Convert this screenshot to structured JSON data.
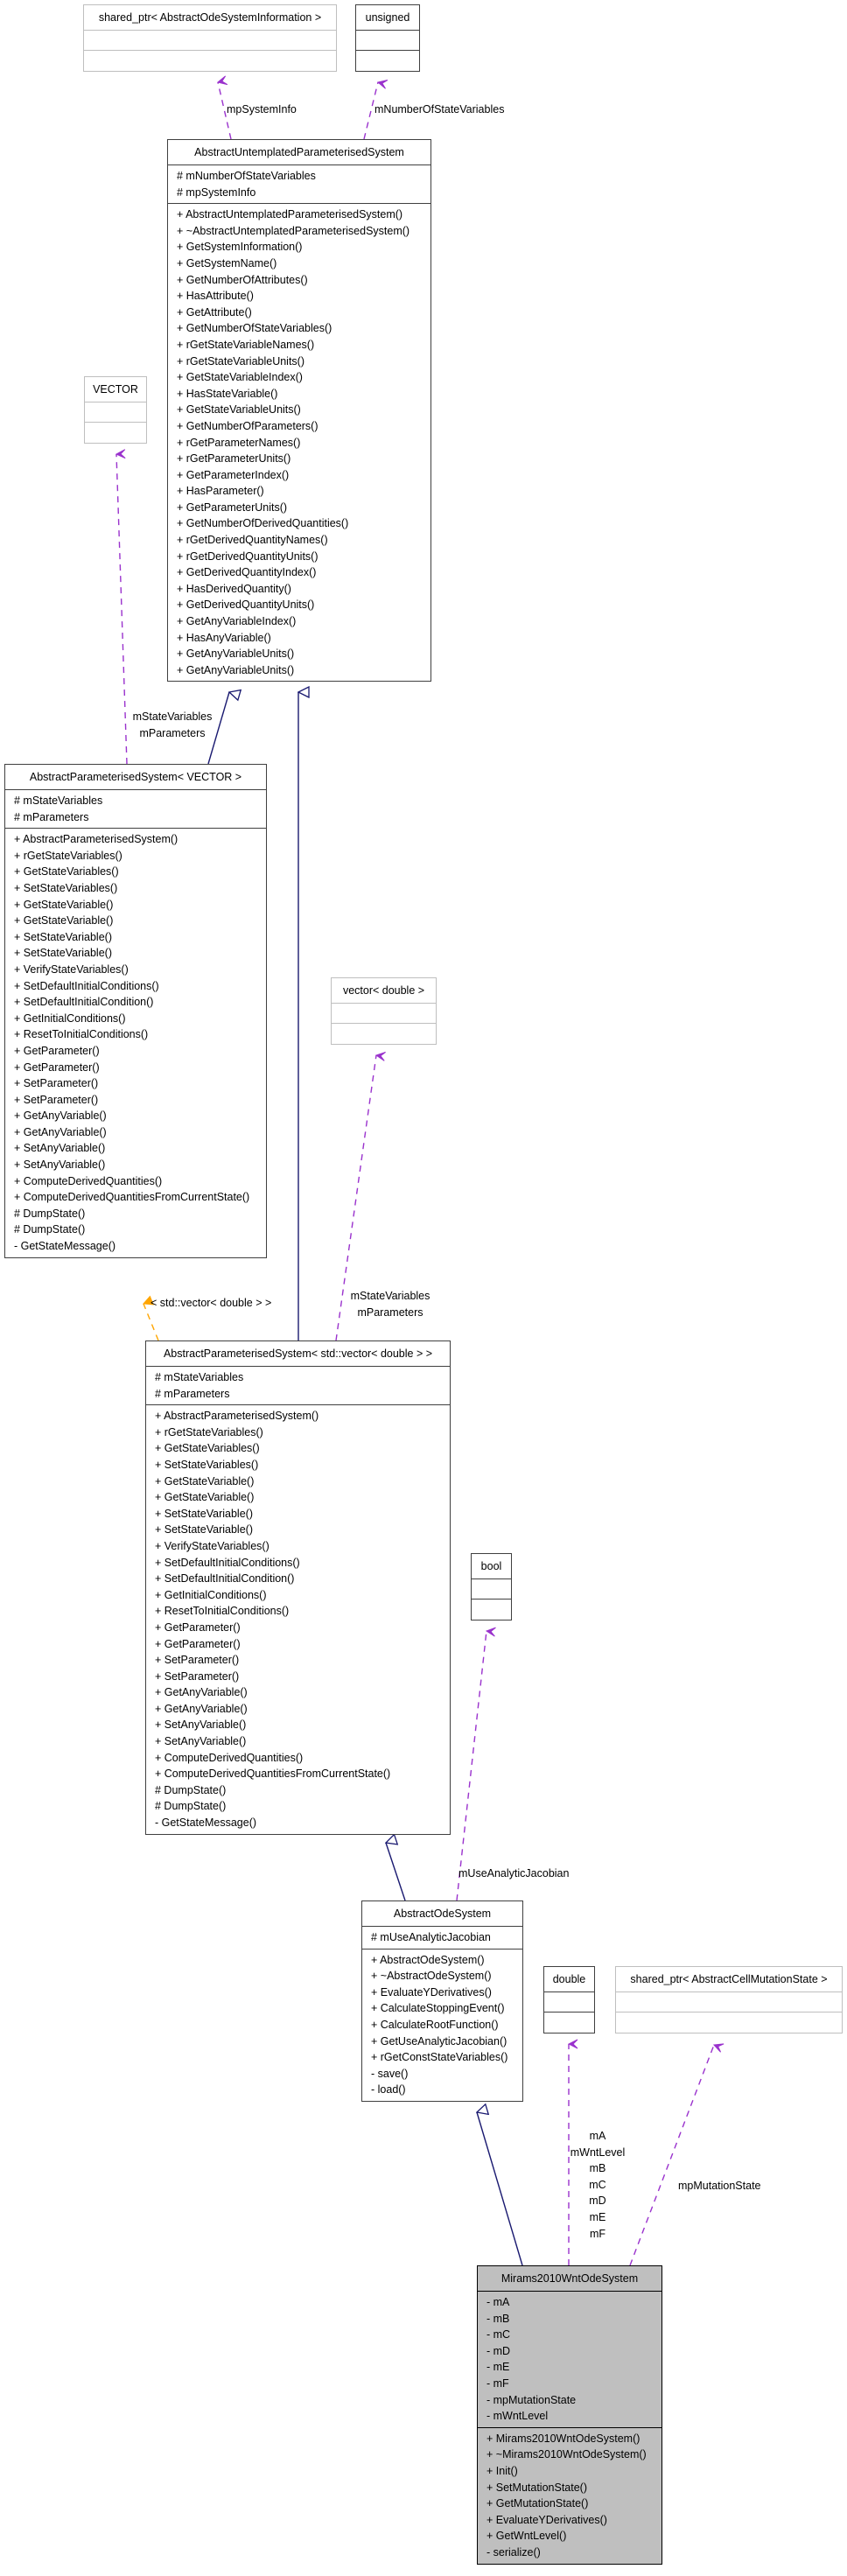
{
  "diagram": {
    "type": "doxygen-collaboration-graph",
    "colors": {
      "inheritance_edge": "#191970",
      "usage_edge": "#9a32cd",
      "template_edge": "#ffa500",
      "focus_fill": "#bfbfbf",
      "external_border": "#bfbfbf"
    }
  },
  "nodes": {
    "shared_ptr_info": {
      "title": "shared_ptr< AbstractOdeSystemInformation >",
      "attributes": [],
      "methods": []
    },
    "unsigned": {
      "title": "unsigned",
      "attributes": [],
      "methods": []
    },
    "untemplated": {
      "title": "AbstractUntemplatedParameterisedSystem",
      "attributes": [
        "# mNumberOfStateVariables",
        "# mpSystemInfo"
      ],
      "methods": [
        "+ AbstractUntemplatedParameterisedSystem()",
        "+ ~AbstractUntemplatedParameterisedSystem()",
        "+ GetSystemInformation()",
        "+ GetSystemName()",
        "+ GetNumberOfAttributes()",
        "+ HasAttribute()",
        "+ GetAttribute()",
        "+ GetNumberOfStateVariables()",
        "+ rGetStateVariableNames()",
        "+ rGetStateVariableUnits()",
        "+ GetStateVariableIndex()",
        "+ HasStateVariable()",
        "+ GetStateVariableUnits()",
        "+ GetNumberOfParameters()",
        "+ rGetParameterNames()",
        "+ rGetParameterUnits()",
        "+ GetParameterIndex()",
        "+ HasParameter()",
        "+ GetParameterUnits()",
        "+ GetNumberOfDerivedQuantities()",
        "+ rGetDerivedQuantityNames()",
        "+ rGetDerivedQuantityUnits()",
        "+ GetDerivedQuantityIndex()",
        "+ HasDerivedQuantity()",
        "+ GetDerivedQuantityUnits()",
        "+ GetAnyVariableIndex()",
        "+ HasAnyVariable()",
        "+ GetAnyVariableUnits()",
        "+ GetAnyVariableUnits()"
      ]
    },
    "vector_tpl": {
      "title": "VECTOR",
      "attributes": [],
      "methods": []
    },
    "param_vector": {
      "title": "AbstractParameterisedSystem< VECTOR >",
      "attributes": [
        "# mStateVariables",
        "# mParameters"
      ],
      "methods": [
        "+ AbstractParameterisedSystem()",
        "+ rGetStateVariables()",
        "+ GetStateVariables()",
        "+ SetStateVariables()",
        "+ GetStateVariable()",
        "+ GetStateVariable()",
        "+ SetStateVariable()",
        "+ SetStateVariable()",
        "+ VerifyStateVariables()",
        "+ SetDefaultInitialConditions()",
        "+ SetDefaultInitialCondition()",
        "+ GetInitialConditions()",
        "+ ResetToInitialConditions()",
        "+ GetParameter()",
        "+ GetParameter()",
        "+ SetParameter()",
        "+ SetParameter()",
        "+ GetAnyVariable()",
        "+ GetAnyVariable()",
        "+ SetAnyVariable()",
        "+ SetAnyVariable()",
        "+ ComputeDerivedQuantities()",
        "+ ComputeDerivedQuantitiesFromCurrentState()",
        "# DumpState()",
        "# DumpState()",
        "- GetStateMessage()"
      ]
    },
    "vector_double": {
      "title": "vector< double >",
      "attributes": [],
      "methods": []
    },
    "param_std_vector": {
      "title": "AbstractParameterisedSystem< std::vector< double > >",
      "attributes": [
        "# mStateVariables",
        "# mParameters"
      ],
      "methods": [
        "+ AbstractParameterisedSystem()",
        "+ rGetStateVariables()",
        "+ GetStateVariables()",
        "+ SetStateVariables()",
        "+ GetStateVariable()",
        "+ GetStateVariable()",
        "+ SetStateVariable()",
        "+ SetStateVariable()",
        "+ VerifyStateVariables()",
        "+ SetDefaultInitialConditions()",
        "+ SetDefaultInitialCondition()",
        "+ GetInitialConditions()",
        "+ ResetToInitialConditions()",
        "+ GetParameter()",
        "+ GetParameter()",
        "+ SetParameter()",
        "+ SetParameter()",
        "+ GetAnyVariable()",
        "+ GetAnyVariable()",
        "+ SetAnyVariable()",
        "+ SetAnyVariable()",
        "+ ComputeDerivedQuantities()",
        "+ ComputeDerivedQuantitiesFromCurrentState()",
        "# DumpState()",
        "# DumpState()",
        "- GetStateMessage()"
      ]
    },
    "bool": {
      "title": "bool",
      "attributes": [],
      "methods": []
    },
    "ode_system": {
      "title": "AbstractOdeSystem",
      "attributes": [
        "# mUseAnalyticJacobian"
      ],
      "methods": [
        "+ AbstractOdeSystem()",
        "+ ~AbstractOdeSystem()",
        "+ EvaluateYDerivatives()",
        "+ CalculateStoppingEvent()",
        "+ CalculateRootFunction()",
        "+ GetUseAnalyticJacobian()",
        "+ rGetConstStateVariables()",
        "- save()",
        "- load()"
      ]
    },
    "double": {
      "title": "double",
      "attributes": [],
      "methods": []
    },
    "shared_ptr_mutation": {
      "title": "shared_ptr< AbstractCellMutationState >",
      "attributes": [],
      "methods": []
    },
    "mirams": {
      "title": "Mirams2010WntOdeSystem",
      "attributes": [
        "- mA",
        "- mB",
        "- mC",
        "- mD",
        "- mE",
        "- mF",
        "- mpMutationState",
        "- mWntLevel"
      ],
      "methods": [
        "+ Mirams2010WntOdeSystem()",
        "+ ~Mirams2010WntOdeSystem()",
        "+ Init()",
        "+ SetMutationState()",
        "+ GetMutationState()",
        "+ EvaluateYDerivatives()",
        "+ GetWntLevel()",
        "- serialize()"
      ]
    }
  },
  "edge_labels": {
    "mpSystemInfo": "mpSystemInfo",
    "mNumberOfStateVariables": "mNumberOfStateVariables",
    "vector_members": [
      "mStateVariables",
      "mParameters"
    ],
    "template_arg": "< std::vector< double > >",
    "vector_double_members": [
      "mStateVariables",
      "mParameters"
    ],
    "mUseAnalyticJacobian": "mUseAnalyticJacobian",
    "double_members": [
      "mA",
      "mWntLevel",
      "mB",
      "mC",
      "mD",
      "mE",
      "mF"
    ],
    "mpMutationState": "mpMutationState"
  }
}
